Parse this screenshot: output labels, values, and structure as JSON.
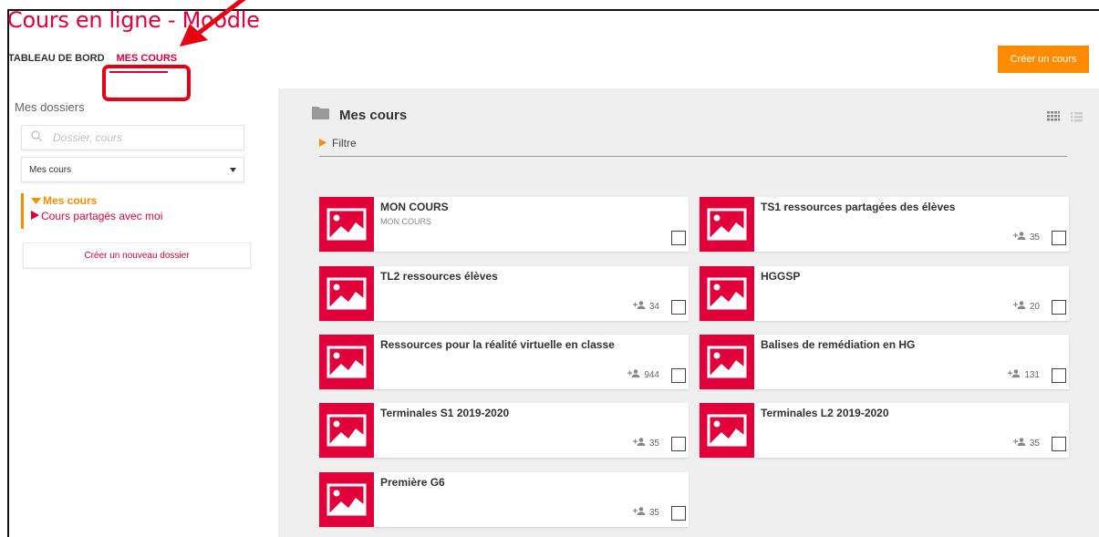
{
  "app": {
    "title": "Cours en ligne - Moodle"
  },
  "nav": {
    "items": [
      {
        "label": "TABLEAU DE BORD"
      },
      {
        "label": "MES COURS"
      }
    ]
  },
  "actions": {
    "create_course": "Créer un cours"
  },
  "sidebar": {
    "title": "Mes dossiers",
    "search_placeholder": "Dossier, cours",
    "select_value": "Mes cours",
    "tree": {
      "mine": "Mes cours",
      "shared": "Cours partagés avec moi"
    },
    "new_folder": "Créer un nouveau dossier"
  },
  "main": {
    "title": "Mes cours",
    "filter_label": "Filtre",
    "courses": [
      {
        "title": "MON COURS",
        "subtitle": "MON COURS",
        "count": ""
      },
      {
        "title": "TS1 ressources partagées des élèves",
        "subtitle": "",
        "count": "35"
      },
      {
        "title": "TL2 ressources élèves",
        "subtitle": "",
        "count": "34"
      },
      {
        "title": "HGGSP",
        "subtitle": "",
        "count": "20"
      },
      {
        "title": "Ressources pour la réalité virtuelle en classe",
        "subtitle": "",
        "count": "944"
      },
      {
        "title": "Balises de remédiation en HG",
        "subtitle": "",
        "count": "131"
      },
      {
        "title": "Terminales S1 2019-2020",
        "subtitle": "",
        "count": "35"
      },
      {
        "title": "Terminales L2 2019-2020",
        "subtitle": "",
        "count": "35"
      },
      {
        "title": "Première G6",
        "subtitle": "",
        "count": "35"
      }
    ]
  },
  "colors": {
    "brand": "#e2003b",
    "accent": "#ff8c00",
    "annotation": "#e60012"
  }
}
